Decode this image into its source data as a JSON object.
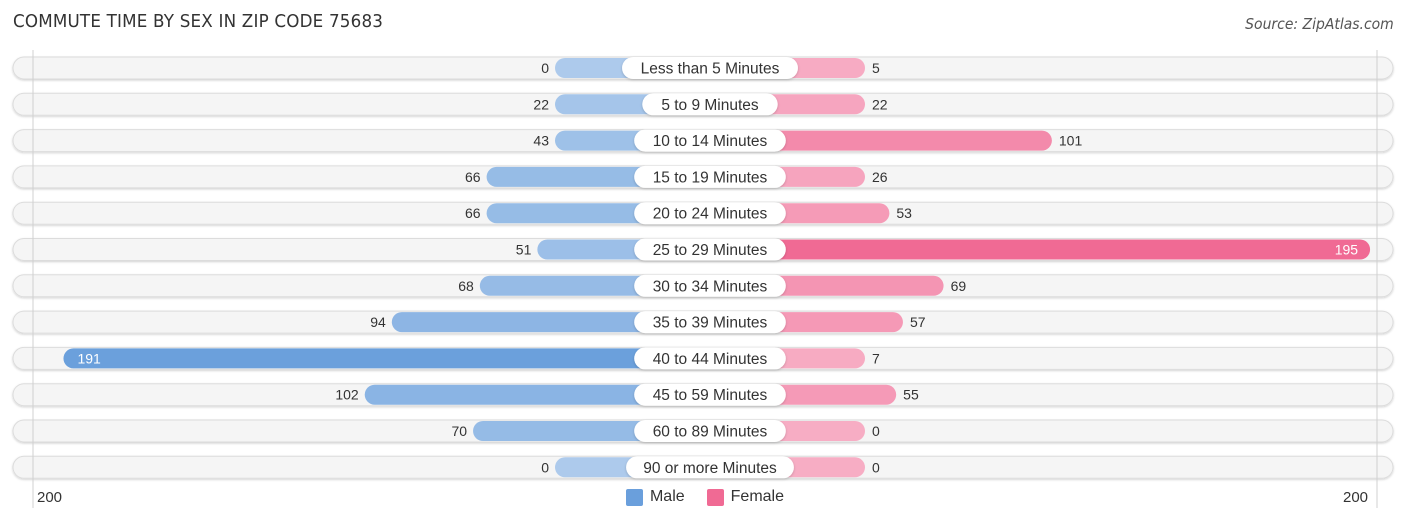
{
  "header": {
    "title": "COMMUTE TIME BY SEX IN ZIP CODE 75683",
    "source": "Source: ZipAtlas.com"
  },
  "chart_data": {
    "type": "bar",
    "orientation": "horizontal-diverging",
    "title": "COMMUTE TIME BY SEX IN ZIP CODE 75683",
    "categories": [
      "Less than 5 Minutes",
      "5 to 9 Minutes",
      "10 to 14 Minutes",
      "15 to 19 Minutes",
      "20 to 24 Minutes",
      "25 to 29 Minutes",
      "30 to 34 Minutes",
      "35 to 39 Minutes",
      "40 to 44 Minutes",
      "45 to 59 Minutes",
      "60 to 89 Minutes",
      "90 or more Minutes"
    ],
    "series": [
      {
        "name": "Male",
        "side": "left",
        "color": "#6a9fdc",
        "values": [
          0,
          22,
          43,
          66,
          66,
          51,
          68,
          94,
          191,
          102,
          70,
          0
        ]
      },
      {
        "name": "Female",
        "side": "right",
        "color": "#f06a94",
        "values": [
          5,
          22,
          101,
          26,
          53,
          195,
          69,
          57,
          7,
          55,
          0,
          0
        ]
      }
    ],
    "axis": {
      "left_max": 200,
      "right_max": 200,
      "left_tick_label": "200",
      "right_tick_label": "200"
    },
    "legend": {
      "position": "bottom-center",
      "entries": [
        "Male",
        "Female"
      ]
    },
    "xlabel": "",
    "ylabel": ""
  },
  "legend": {
    "male_label": "Male",
    "female_label": "Female",
    "male_color": "#6a9fdc",
    "female_color": "#f06a94"
  }
}
